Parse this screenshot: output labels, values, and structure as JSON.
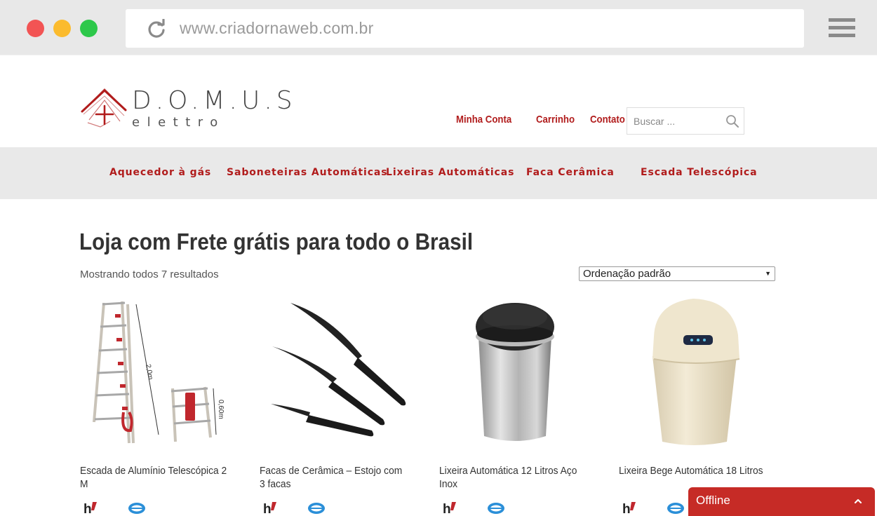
{
  "browser": {
    "url": "www.criadornaweb.com.br"
  },
  "logo": {
    "title": "D.O.M.U.S",
    "subtitle": "elettro",
    "brand_color": "#b11c1c"
  },
  "top_nav": [
    "Minha Conta",
    "Carrinho",
    "Contato"
  ],
  "search": {
    "placeholder": "Buscar ..."
  },
  "categories": [
    "Aquecedor à gás",
    "Saboneteiras Automáticas",
    "Lixeiras Automáticas",
    "Faca Cerâmica",
    "Escada Telescópica"
  ],
  "main": {
    "title": "Loja com Frete grátis para todo o Brasil",
    "result_count": "Mostrando todos 7 resultados",
    "orderby_selected": "Ordenação padrão"
  },
  "products": [
    {
      "name": "Escada de Alumínio Telescópica 2 M",
      "image_label_a": "2,0m",
      "image_label_b": "0,60m"
    },
    {
      "name": "Facas de Cerâmica – Estojo com 3 facas"
    },
    {
      "name": "Lixeira Automática 12 Litros Aço Inox"
    },
    {
      "name": "Lixeira Bege Automática 18 Litros"
    }
  ],
  "chat": {
    "status": "Offline",
    "color": "#c62b26"
  }
}
